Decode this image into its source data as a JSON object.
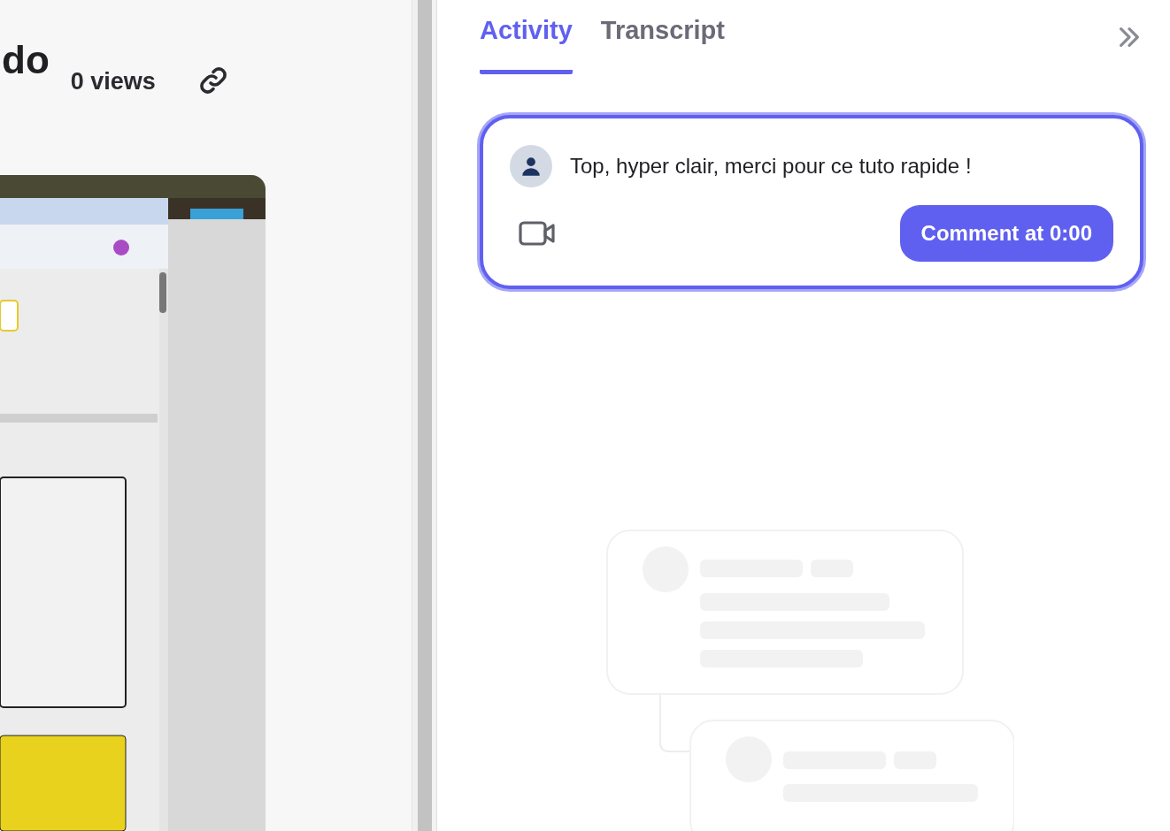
{
  "video": {
    "title": "do",
    "views": "0 views"
  },
  "panel": {
    "tabs": [
      {
        "label": "Activity",
        "selected": true
      },
      {
        "label": "Transcript",
        "selected": false
      }
    ],
    "comment": {
      "value": "Top, hyper clair, merci pour ce tuto rapide !",
      "button": "Comment at 0:00"
    }
  }
}
